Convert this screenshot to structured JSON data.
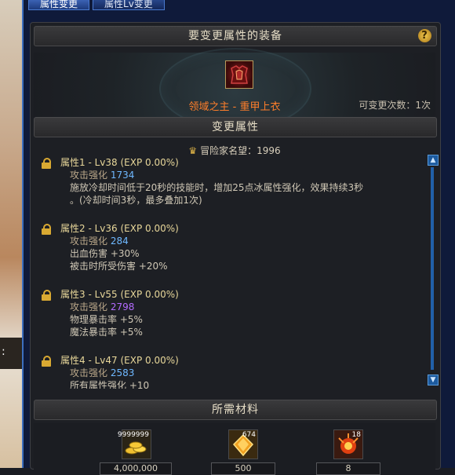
{
  "tabs": [
    {
      "label": "属性变更",
      "active": true
    },
    {
      "label": "属性Lv变更",
      "active": false
    }
  ],
  "header": {
    "equip_title": "要变更属性的装备",
    "help": "?"
  },
  "equipment": {
    "name": "领域之主 - 重甲上衣",
    "remain_label": "可变更次数：1次"
  },
  "change_header": "变更属性",
  "adventurer": {
    "label": "冒险家名望：1996"
  },
  "attributes": [
    {
      "title": "属性1 - Lv38 (EXP 0.00%)",
      "atk_label": "攻击强化",
      "atk_value": "1734",
      "lines": [
        "施放冷却时间低于20秒的技能时，增加25点冰属性强化，效果持续3秒",
        "。(冷却时间3秒，最多叠加1次)"
      ]
    },
    {
      "title": "属性2 - Lv36 (EXP 0.00%)",
      "atk_label": "攻击强化",
      "atk_value": "284",
      "lines": [
        "出血伤害 +30%",
        "被击时所受伤害 +20%"
      ]
    },
    {
      "title": "属性3 - Lv55 (EXP 0.00%)",
      "atk_label": "攻击强化",
      "atk_value": "2798",
      "lines": [
        "物理暴击率 +5%",
        "魔法暴击率 +5%"
      ]
    },
    {
      "title": "属性4 - Lv47 (EXP 0.00%)",
      "atk_label": "攻击强化",
      "atk_value": "2583",
      "lines": [
        "所有属性强化 +10"
      ]
    }
  ],
  "materials_header": "所需材料",
  "materials": [
    {
      "icon": "gold-coins-icon",
      "count": "9999999",
      "value": "4,000,000"
    },
    {
      "icon": "gold-crystal-icon",
      "count": "674",
      "value": "500"
    },
    {
      "icon": "fire-orb-icon",
      "count": "18",
      "value": "8"
    }
  ],
  "colors": {
    "window_border": "#3d6fc0",
    "equip_name": "#ff7e2a",
    "atk_blue": "#6fb8ff",
    "atk_purple": "#b36bff"
  }
}
